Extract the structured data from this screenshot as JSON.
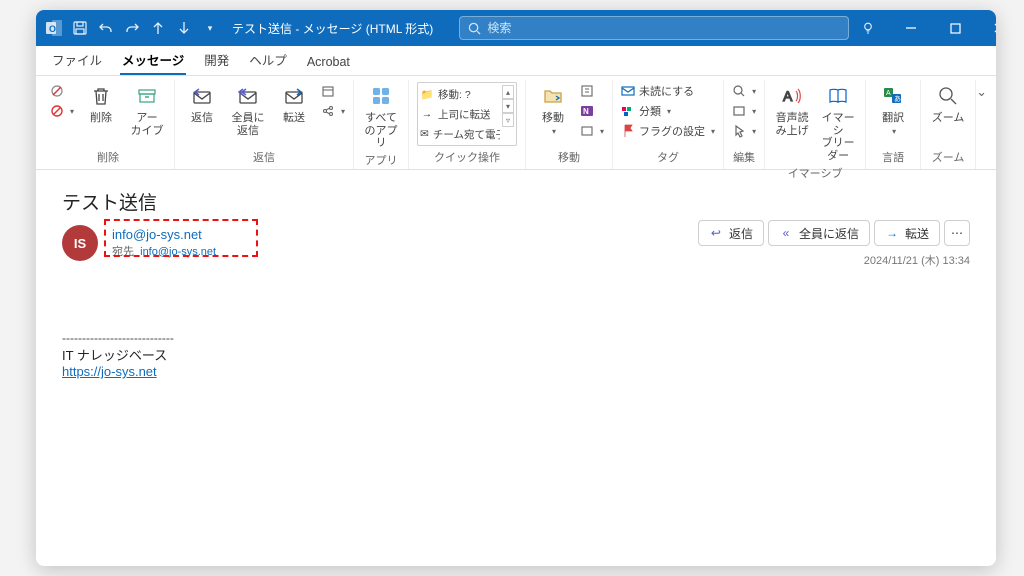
{
  "titlebar": {
    "app_icon": "outlook-icon",
    "title": "テスト送信  -  メッセージ (HTML 形式)"
  },
  "search": {
    "placeholder": "検索"
  },
  "tabs": {
    "file": "ファイル",
    "message": "メッセージ",
    "developer": "開発",
    "help": "ヘルプ",
    "acrobat": "Acrobat"
  },
  "ribbon": {
    "delete_group": "削除",
    "delete": "削除",
    "archive": "アー\nカイブ",
    "reply_group": "返信",
    "reply": "返信",
    "reply_all": "全員に\n返信",
    "forward": "転送",
    "apps_group": "アプリ",
    "all_apps": "すべて\nのアプリ",
    "quick_group": "クイック操作",
    "quick_move_label": "移動: ?",
    "quick_to_manager": "上司に転送",
    "quick_team": "チーム宛て電子メ…",
    "move_group": "移動",
    "move": "移動",
    "tag_group": "タグ",
    "mark_unread": "未読にする",
    "categorize": "分類",
    "flag": "フラグの設定",
    "edit_group": "編集",
    "immersive_group": "イマーシブ",
    "read_aloud": "音声読\nみ上げ",
    "immersive_reader": "イマーシ\nブリーダー",
    "lang_group": "言語",
    "translate": "翻訳",
    "zoom_group": "ズーム",
    "zoom": "ズーム"
  },
  "message": {
    "subject": "テスト送信",
    "avatar": "IS",
    "from": "info@jo-sys.net",
    "to_label": "宛先",
    "to": "info@jo-sys.net",
    "datetime": "2024/11/21 (木) 13:34",
    "separator": "----------------------------",
    "sig1": "IT ナレッジベース",
    "sig_link": "https://jo-sys.net"
  },
  "actions": {
    "reply": "返信",
    "reply_all": "全員に返信",
    "forward": "転送"
  }
}
